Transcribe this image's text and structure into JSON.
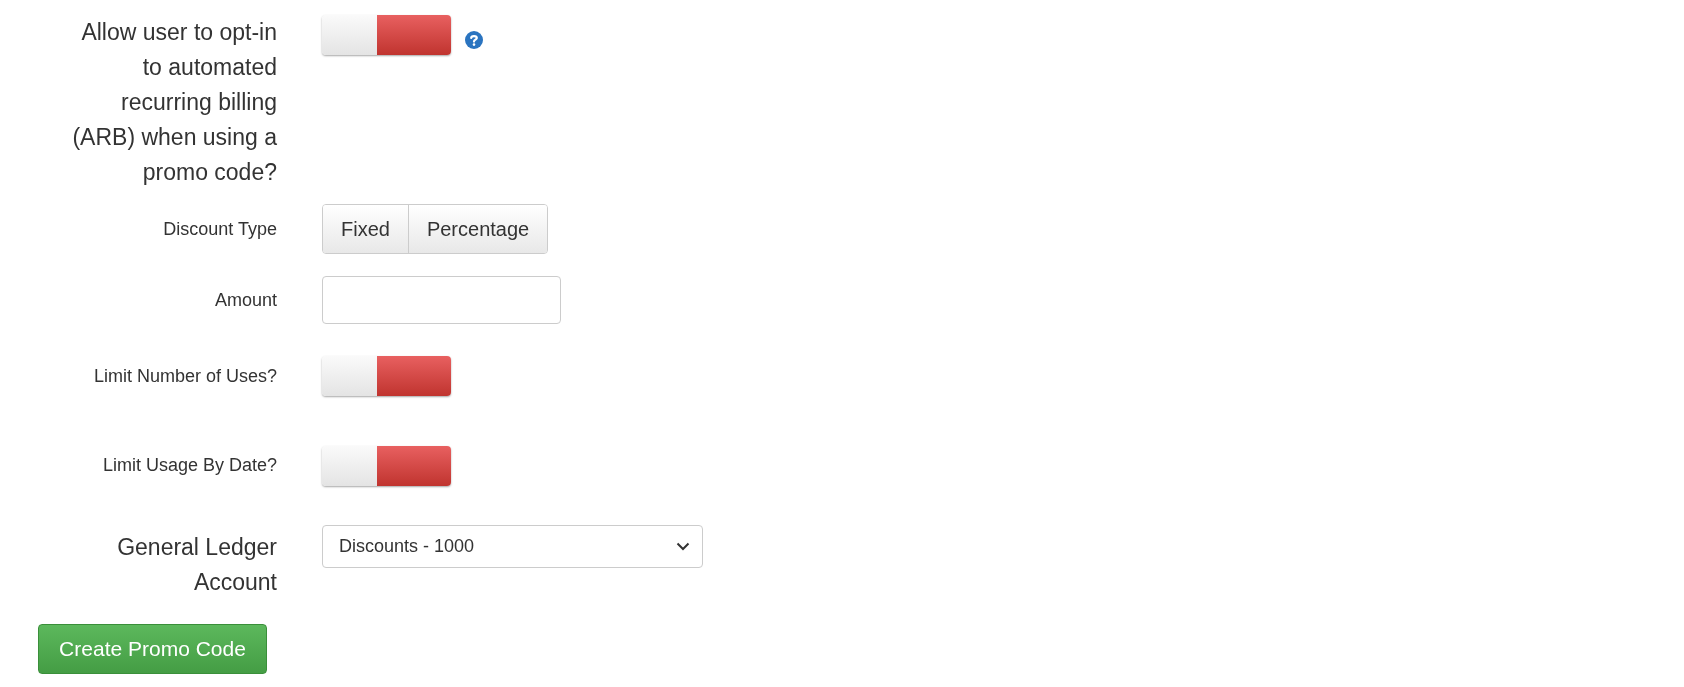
{
  "fields": [
    {
      "kind": "toggle",
      "label": "Allow user to opt-in to automated recurring billing (ARB) when using a promo code?",
      "on": false,
      "help": true
    },
    {
      "kind": "segmented",
      "label": "Discount Type",
      "options": [
        {
          "label": "Fixed",
          "selected": false
        },
        {
          "label": "Percentage",
          "selected": false
        }
      ]
    },
    {
      "kind": "text",
      "label": "Amount"
    },
    {
      "kind": "toggle",
      "label": "Limit Number of Uses?",
      "on": false,
      "help": false
    },
    {
      "kind": "toggle",
      "label": "Limit Usage By Date?",
      "on": false,
      "help": false
    },
    {
      "kind": "select",
      "label": "General Ledger Account",
      "value": "Discounts - 1000"
    }
  ],
  "submit": "Create Promo Code"
}
